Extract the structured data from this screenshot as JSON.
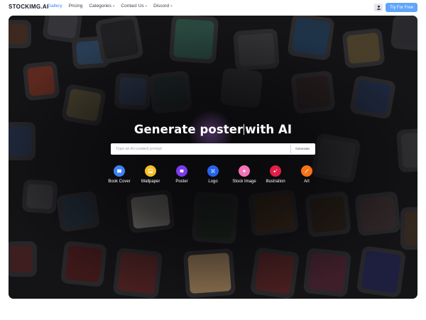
{
  "brand": "STOCKIMG.AI",
  "nav": {
    "links": [
      {
        "label": "Gallery",
        "active": true,
        "dropdown": false
      },
      {
        "label": "Pricing",
        "active": false,
        "dropdown": false
      },
      {
        "label": "Categories",
        "active": false,
        "dropdown": true
      },
      {
        "label": "Contact Us",
        "active": false,
        "dropdown": true
      },
      {
        "label": "Discord",
        "active": false,
        "dropdown": true
      }
    ],
    "user_icon": "user-icon",
    "try_label": "Try For Free"
  },
  "hero": {
    "title_part1": "Generate poster",
    "title_part2": "with AI",
    "search_placeholder": "Type an AI-curated prompt",
    "generate_label": "Generate"
  },
  "categories": [
    {
      "label": "Book Cover",
      "icon": "book-icon",
      "color": "#3b82f6"
    },
    {
      "label": "Wallpaper",
      "icon": "wallpaper-icon",
      "color": "#fbbf24"
    },
    {
      "label": "Poster",
      "icon": "poster-icon",
      "color": "#7c3aed"
    },
    {
      "label": "Logo",
      "icon": "logo-icon",
      "color": "#2563eb"
    },
    {
      "label": "Stock Image",
      "icon": "stock-image-icon",
      "color": "#f472b6"
    },
    {
      "label": "Illustration",
      "icon": "illustration-icon",
      "color": "#e11d48"
    },
    {
      "label": "Art",
      "icon": "art-icon",
      "color": "#f97316"
    }
  ],
  "colors": {
    "accent": "#60a5fa",
    "active_link": "#3b82f6",
    "hero_bg": "#1a1a1c"
  }
}
